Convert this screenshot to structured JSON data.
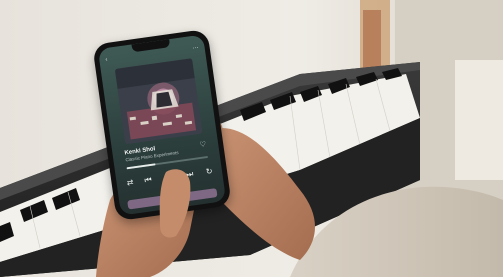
{
  "player": {
    "artist": "Kenki Shol",
    "song": "Classic Piano Experiments",
    "icons": {
      "back": "chevron-left-icon",
      "menu": "more-icon",
      "favorite": "heart-icon",
      "shuffle": "shuffle-icon",
      "previous": "previous-icon",
      "play": "play-icon",
      "next": "next-icon",
      "repeat": "repeat-icon"
    }
  }
}
